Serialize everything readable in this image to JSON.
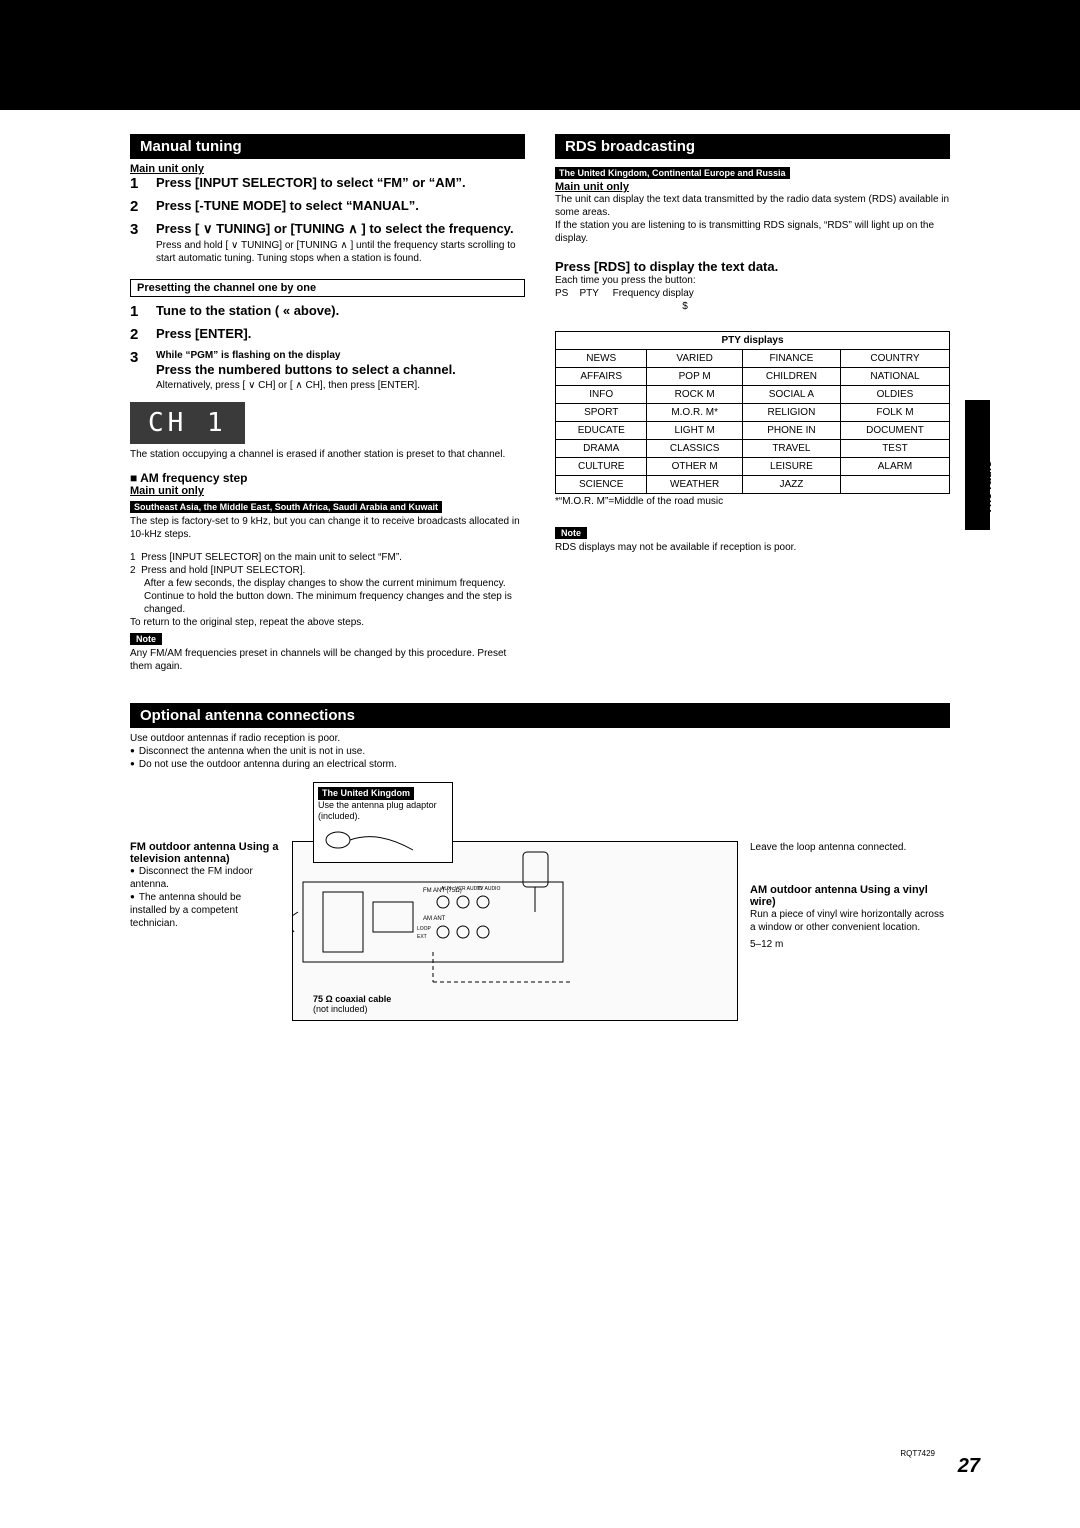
{
  "header": {
    "manual_tuning": "Manual tuning",
    "rds": "RDS broadcasting",
    "optional_antenna": "Optional antenna connections"
  },
  "labels": {
    "main_unit_only": "Main unit only",
    "region_rds": "The United Kingdom, Continental Europe and Russia",
    "region_am": "Southeast Asia, the Middle East, South Africa, Saudi Arabia and Kuwait",
    "region_uk": "The United Kingdom",
    "note": "Note",
    "side_tab": "The radio",
    "page": "27",
    "doc_id": "RQT7429"
  },
  "manual_tuning_steps": [
    {
      "title": "Press [INPUT SELECTOR] to select “FM” or “AM”."
    },
    {
      "title": "Press [-TUNE MODE] to select “MANUAL”."
    },
    {
      "title": "Press [ ∨ TUNING] or [TUNING ∧ ] to select the frequency.",
      "sub": "Press and hold [ ∨ TUNING] or [TUNING ∧ ] until the frequency starts scrolling to start automatic tuning. Tuning stops when a station is found."
    }
  ],
  "preset_subhead": "Presetting the channel one by one",
  "preset_steps": [
    {
      "title": "Tune to the station ( « above)."
    },
    {
      "title": "Press [ENTER]."
    },
    {
      "pretext": "While “PGM” is flashing on the display",
      "title": "Press the numbered buttons to select a channel.",
      "sub": "Alternatively, press [ ∨ CH] or [ ∧ CH], then press [ENTER]."
    }
  ],
  "ch_display": "CH   1",
  "preset_after": "The station occupying a channel is erased if another station is preset to that channel.",
  "am_freq": {
    "head": "AM frequency step",
    "p1": "The step is factory-set to 9 kHz, but you can change it to receive broadcasts allocated in 10-kHz steps.",
    "li1": "Press [INPUT SELECTOR] on the main unit to select “FM”.",
    "li2": "Press and hold [INPUT SELECTOR].",
    "li2sub": "After a few seconds, the display changes to show the current minimum frequency. Continue to hold the button down. The minimum frequency changes and the step is changed.",
    "p2": "To return to the original step, repeat the above steps.",
    "note_text": "Any FM/AM frequencies preset in channels will be changed by this procedure. Preset them again."
  },
  "rds": {
    "intro1": "The unit can display the text data transmitted by the radio data system (RDS) available in some areas.",
    "intro2": "If the station you are listening to is transmitting RDS signals, “RDS” will light up on the display.",
    "press_head": "Press [RDS] to display the text data.",
    "each": "Each time you press the button:",
    "cycle": "PS    PTY     Frequency display",
    "arrow": "$",
    "table_title": "PTY displays",
    "table": [
      [
        "NEWS",
        "VARIED",
        "FINANCE",
        "COUNTRY"
      ],
      [
        "AFFAIRS",
        "POP M",
        "CHILDREN",
        "NATIONAL"
      ],
      [
        "INFO",
        "ROCK M",
        "SOCIAL A",
        "OLDIES"
      ],
      [
        "SPORT",
        "M.O.R. M*",
        "RELIGION",
        "FOLK M"
      ],
      [
        "EDUCATE",
        "LIGHT M",
        "PHONE IN",
        "DOCUMENT"
      ],
      [
        "DRAMA",
        "CLASSICS",
        "TRAVEL",
        "TEST"
      ],
      [
        "CULTURE",
        "OTHER M",
        "LEISURE",
        "ALARM"
      ],
      [
        "SCIENCE",
        "WEATHER",
        "JAZZ",
        ""
      ]
    ],
    "footnote": "*“M.O.R. M”=Middle of the road music",
    "note_text": "RDS displays may not be available if reception is poor."
  },
  "antenna_intro": {
    "l1": "Use outdoor antennas if radio reception is poor.",
    "b1": "Disconnect the antenna when the unit is not in use.",
    "b2": "Do not use the outdoor antenna during an electrical storm."
  },
  "antenna_left": {
    "head": "FM outdoor antenna Using a television antenna)",
    "b1": "Disconnect the FM indoor antenna.",
    "b2": "The antenna should be installed by a competent technician."
  },
  "antenna_callout": {
    "l2": "Use the antenna plug adaptor (included)."
  },
  "antenna_cable": {
    "l1": "75 Ω coaxial cable",
    "l2": "(not included)"
  },
  "antenna_right": {
    "loop": "Leave the loop antenna connected.",
    "head": "AM outdoor antenna Using a vinyl wire)",
    "p": "Run a piece of vinyl wire horizontally across a window or other convenient location.",
    "len": "5–12 m"
  }
}
